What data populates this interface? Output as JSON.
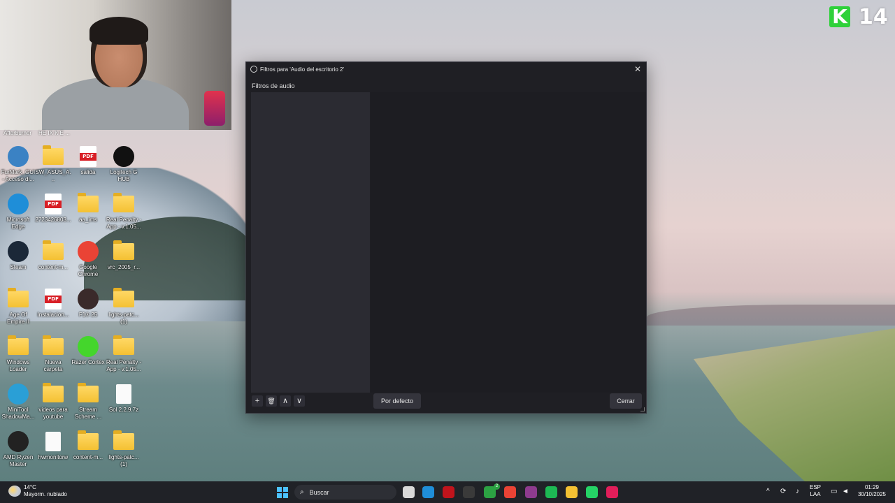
{
  "webcam": {
    "overlay_left": "Afterburner",
    "overlay_right": "HE IX K E ..."
  },
  "desktop_icons": [
    {
      "label": "FurMark_GUI - Acceso di...",
      "type": "app",
      "color": "#3b82c4"
    },
    {
      "label": "SW_ASUS_A...",
      "type": "folder"
    },
    {
      "label": "salida",
      "type": "pdf"
    },
    {
      "label": "Logitech G HUB",
      "type": "app",
      "color": "#111111"
    },
    {
      "label": "Microsoft Edge",
      "type": "app",
      "color": "#1f8ed8"
    },
    {
      "label": "2723426803...",
      "type": "pdf"
    },
    {
      "label": "aa_ims",
      "type": "folder"
    },
    {
      "label": "Real Penalty - App - v.1.05...",
      "type": "folder"
    },
    {
      "label": "Steam",
      "type": "app",
      "color": "#1b2838"
    },
    {
      "label": "content-m...",
      "type": "folder"
    },
    {
      "label": "Google Chrome",
      "type": "app",
      "color": "#ea4335"
    },
    {
      "label": "vrc_2005_r...",
      "type": "folder"
    },
    {
      "label": "Age Of Empire II",
      "type": "folder"
    },
    {
      "label": "Instalacion...",
      "type": "pdf"
    },
    {
      "label": "F1® 25",
      "type": "app",
      "color": "#3a2a2a"
    },
    {
      "label": "lights-patc... (1)",
      "type": "folder"
    },
    {
      "label": "Windows Loader",
      "type": "folder"
    },
    {
      "label": "Nueva carpeta",
      "type": "folder"
    },
    {
      "label": "Razer Cortex",
      "type": "app",
      "color": "#44d62c"
    },
    {
      "label": "Real Penalty - App - v.1.05...",
      "type": "folder"
    },
    {
      "label": "MiniTool ShadowMa...",
      "type": "app",
      "color": "#2a9fd6"
    },
    {
      "label": "videos para youtube",
      "type": "folder"
    },
    {
      "label": "Stream Scheme ...",
      "type": "folder"
    },
    {
      "label": "Sol 2.2.9.7z",
      "type": "file"
    },
    {
      "label": "AMD Ryzen Master",
      "type": "app",
      "color": "#222222"
    },
    {
      "label": "hwmonitorw",
      "type": "file"
    },
    {
      "label": "content-m...",
      "type": "folder"
    },
    {
      "label": "lights-patc... (1)",
      "type": "folder"
    }
  ],
  "dialog": {
    "title": "Filtros para 'Audio del escritorio 2'",
    "close_glyph": "✕",
    "section_label": "Filtros de audio",
    "add_glyph": "+",
    "remove_glyph": "🗑",
    "up_glyph": "∧",
    "down_glyph": "∨",
    "defaults_button": "Por defecto",
    "close_button": "Cerrar"
  },
  "overlay_logo": {
    "letter": "K",
    "number": "14"
  },
  "taskbar": {
    "weather_temp": "14°C",
    "weather_desc": "Mayorm. nublado",
    "search_placeholder": "Buscar",
    "search_glyph": "⌕",
    "apps": [
      {
        "name": "file-explorer-app-icon",
        "color": "#d9d9d9"
      },
      {
        "name": "edge-app-icon",
        "color": "#1f8ed8"
      },
      {
        "name": "red-app-icon",
        "color": "#c0141c"
      },
      {
        "name": "obs-app-icon",
        "color": "#3a3a3a"
      },
      {
        "name": "xbox-app-icon",
        "color": "#2ca243"
      },
      {
        "name": "chrome-app-icon",
        "color": "#ea4335"
      },
      {
        "name": "winrar-app-icon",
        "color": "#8e3b8e"
      },
      {
        "name": "spotify-app-icon",
        "color": "#1db954"
      },
      {
        "name": "folder-app-icon",
        "color": "#f4c133"
      },
      {
        "name": "whatsapp-app-icon",
        "color": "#25d366"
      },
      {
        "name": "tiktok-app-icon",
        "color": "#e11e5a"
      }
    ],
    "xbox_badge": "2",
    "tray_chevron": "^",
    "language_top": "ESP",
    "language_bottom": "LAA",
    "time": "01:29",
    "date": "30/10/2025"
  }
}
